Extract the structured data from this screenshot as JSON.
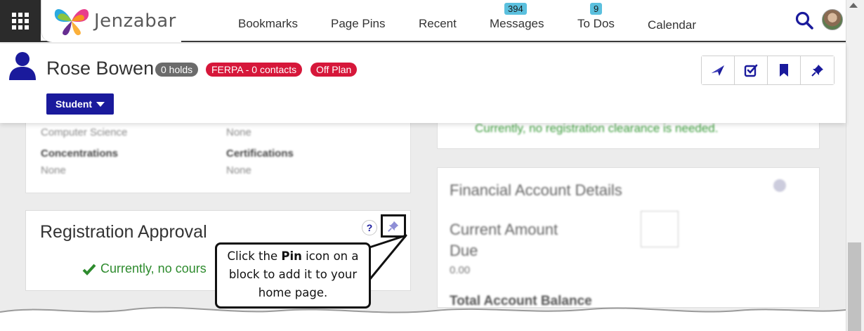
{
  "nav": {
    "logo_text": "Jenzabar",
    "items": [
      {
        "label": "Bookmarks",
        "badge": ""
      },
      {
        "label": "Page Pins",
        "badge": ""
      },
      {
        "label": "Recent",
        "badge": ""
      },
      {
        "label": "Messages",
        "badge": "394"
      },
      {
        "label": "To Dos",
        "badge": "9"
      },
      {
        "label": "Calendar",
        "badge": ""
      }
    ]
  },
  "profile": {
    "name": "Rose Bowen",
    "holds_label": "0 holds",
    "ferpa_label": "FERPA - 0 contacts",
    "plan_label": "Off Plan",
    "role_button": "Student"
  },
  "background": {
    "major_value": "Computer Science",
    "minor_value": "None",
    "concentrations_label": "Concentrations",
    "concentrations_value": "None",
    "certifications_label": "Certifications",
    "certifications_value": "None",
    "registration_hold_note": "Currently, no registration clearance is needed.",
    "financial_title": "Financial Account Details",
    "current_amount_label": "Current Amount Due",
    "current_amount_value": "0.00",
    "total_balance_label": "Total Account Balance"
  },
  "registration": {
    "title": "Registration Approval",
    "help_label": "?",
    "status": "Currently, no cours"
  },
  "callout": {
    "prefix": "Click the",
    "bold": "Pin",
    "suffix": "icon on a block to add it to your home page."
  },
  "colors": {
    "brand_blue": "#1a1a9c",
    "badge_red": "#d6173a",
    "badge_gray": "#6b6b6b",
    "success_green": "#2e8b2e",
    "badge_blue": "#5bc0de"
  }
}
